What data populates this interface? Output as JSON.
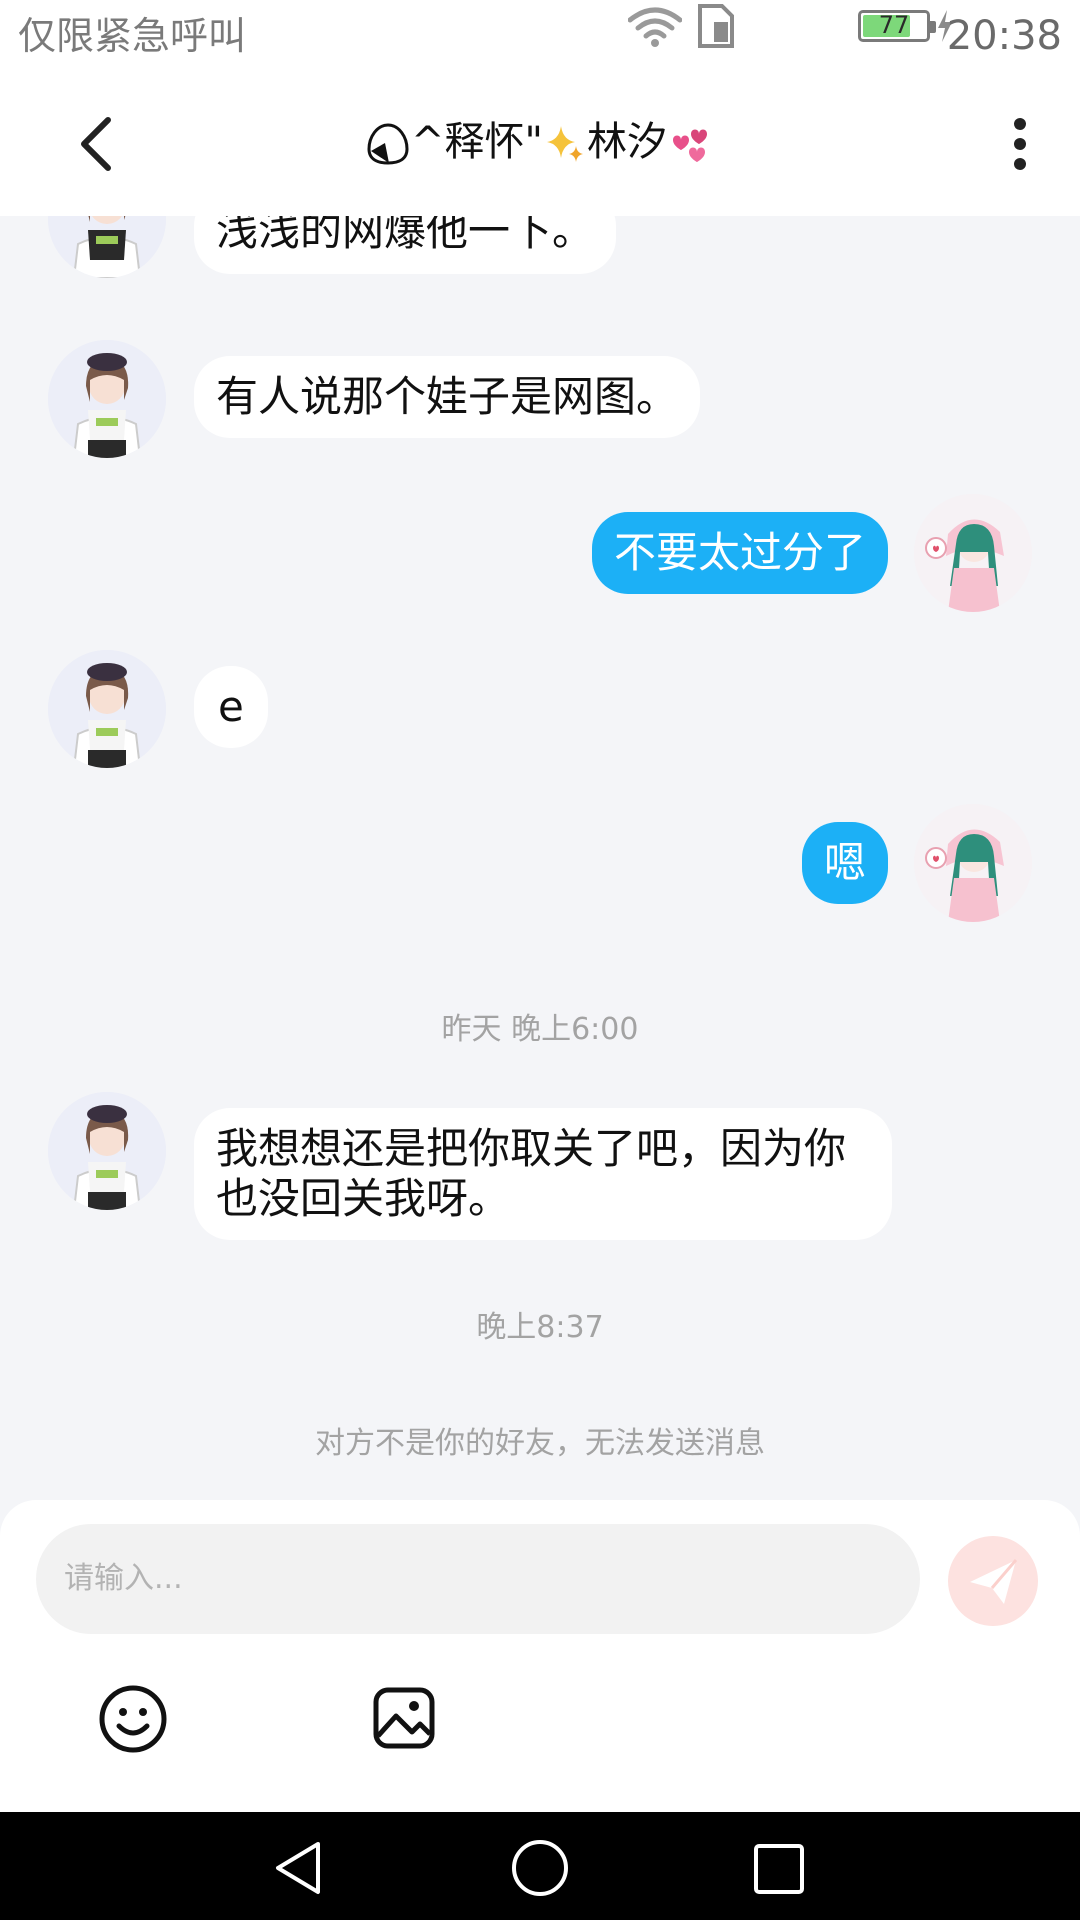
{
  "status_bar": {
    "carrier_text": "仅限紧急呼叫",
    "battery_level": "77",
    "battery_fraction": 0.77,
    "time": "20:38"
  },
  "header": {
    "title_prefix": "^释怀\"",
    "title_suffix": "林汐",
    "back_icon": "chevron-left-icon",
    "more_icon": "more-vertical-icon"
  },
  "chat": {
    "messages": [
      {
        "side": "in",
        "text": "浅浅的网爆他一下。"
      },
      {
        "side": "in",
        "text": "有人说那个娃子是网图。"
      },
      {
        "side": "out",
        "text": "不要太过分了"
      },
      {
        "side": "in",
        "text": "e"
      },
      {
        "side": "out",
        "text": "嗯"
      },
      {
        "side": "in",
        "text": "我想想还是把你取关了吧，因为你也没回关我呀。"
      }
    ],
    "timestamps": [
      "昨天 晚上6:00",
      "晚上8:37"
    ],
    "system_note": "对方不是你的好友，无法发送消息"
  },
  "input": {
    "placeholder": "请输入...",
    "send_icon": "paper-plane-icon",
    "emoji_icon": "smiley-icon",
    "image_icon": "image-icon"
  },
  "colors": {
    "outgoing_bubble": "#1cb0f6",
    "incoming_bubble": "#ffffff",
    "background": "#f4f5f8",
    "send_button": "#fde2e0"
  }
}
